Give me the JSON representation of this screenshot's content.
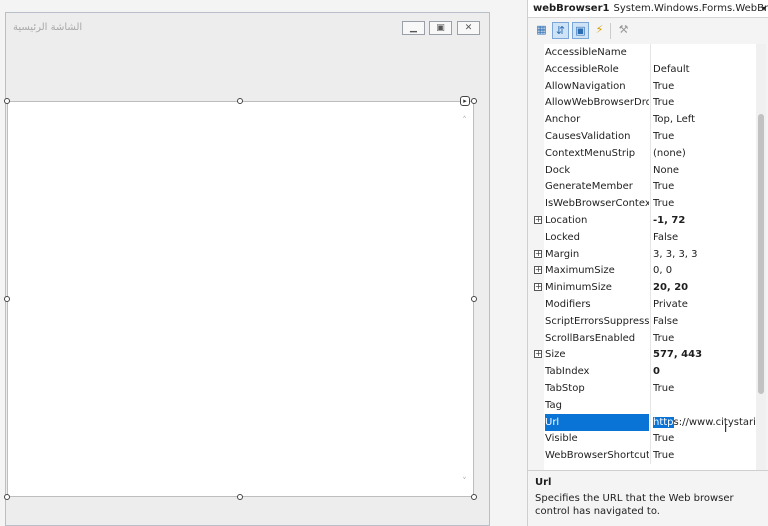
{
  "form": {
    "title": "الشاشة الرئيسية",
    "minimize_icon": "▁",
    "maximize_icon": "▣",
    "close_icon": "✕"
  },
  "control": {
    "scroll_up_glyph": "˄",
    "scroll_down_glyph": "˅",
    "smart_tag_glyph": "▸"
  },
  "properties": {
    "object_name": "webBrowser1",
    "object_type": "System.Windows.Forms.WebBrowse",
    "dropdown_glyph": "▾",
    "toolbar": [
      {
        "name": "categorized-icon",
        "glyph": "▦"
      },
      {
        "name": "alphabetical-icon",
        "glyph": "⇵"
      },
      {
        "name": "properties-icon",
        "glyph": "▣"
      },
      {
        "name": "events-icon",
        "glyph": "⚡"
      },
      {
        "name": "property-pages-icon",
        "glyph": "⚒"
      }
    ],
    "rows": [
      {
        "name": "AccessibleName",
        "value": "",
        "expandable": false,
        "bold": false
      },
      {
        "name": "AccessibleRole",
        "value": "Default",
        "expandable": false,
        "bold": false
      },
      {
        "name": "AllowNavigation",
        "value": "True",
        "expandable": false,
        "bold": false
      },
      {
        "name": "AllowWebBrowserDrop",
        "value": "True",
        "expandable": false,
        "bold": false
      },
      {
        "name": "Anchor",
        "value": "Top, Left",
        "expandable": false,
        "bold": false
      },
      {
        "name": "CausesValidation",
        "value": "True",
        "expandable": false,
        "bold": false
      },
      {
        "name": "ContextMenuStrip",
        "value": "(none)",
        "expandable": false,
        "bold": false
      },
      {
        "name": "Dock",
        "value": "None",
        "expandable": false,
        "bold": false
      },
      {
        "name": "GenerateMember",
        "value": "True",
        "expandable": false,
        "bold": false
      },
      {
        "name": "IsWebBrowserContextMe",
        "value": "True",
        "expandable": false,
        "bold": false
      },
      {
        "name": "Location",
        "value": "-1, 72",
        "expandable": true,
        "bold": true
      },
      {
        "name": "Locked",
        "value": "False",
        "expandable": false,
        "bold": false
      },
      {
        "name": "Margin",
        "value": "3, 3, 3, 3",
        "expandable": true,
        "bold": false
      },
      {
        "name": "MaximumSize",
        "value": "0, 0",
        "expandable": true,
        "bold": false
      },
      {
        "name": "MinimumSize",
        "value": "20, 20",
        "expandable": true,
        "bold": true
      },
      {
        "name": "Modifiers",
        "value": "Private",
        "expandable": false,
        "bold": false
      },
      {
        "name": "ScriptErrorsSuppressed",
        "value": "False",
        "expandable": false,
        "bold": false
      },
      {
        "name": "ScrollBarsEnabled",
        "value": "True",
        "expandable": false,
        "bold": false
      },
      {
        "name": "Size",
        "value": "577, 443",
        "expandable": true,
        "bold": true
      },
      {
        "name": "TabIndex",
        "value": "0",
        "expandable": false,
        "bold": true
      },
      {
        "name": "TabStop",
        "value": "True",
        "expandable": false,
        "bold": false
      },
      {
        "name": "Tag",
        "value": "",
        "expandable": false,
        "bold": false
      },
      {
        "name": "Url",
        "value": "https://www.citystarit.c",
        "value_highlight": "http",
        "value_rest": "s://www.citystarit.c",
        "expandable": false,
        "bold": false,
        "selected": true
      },
      {
        "name": "Visible",
        "value": "True",
        "expandable": false,
        "bold": false
      },
      {
        "name": "WebBrowserShortcutsEn",
        "value": "True",
        "expandable": false,
        "bold": false
      }
    ],
    "expand_glyph": "+",
    "cursor_glyph": "I",
    "description": {
      "title": "Url",
      "text": "Specifies the URL that the Web browser control has navigated to."
    }
  }
}
